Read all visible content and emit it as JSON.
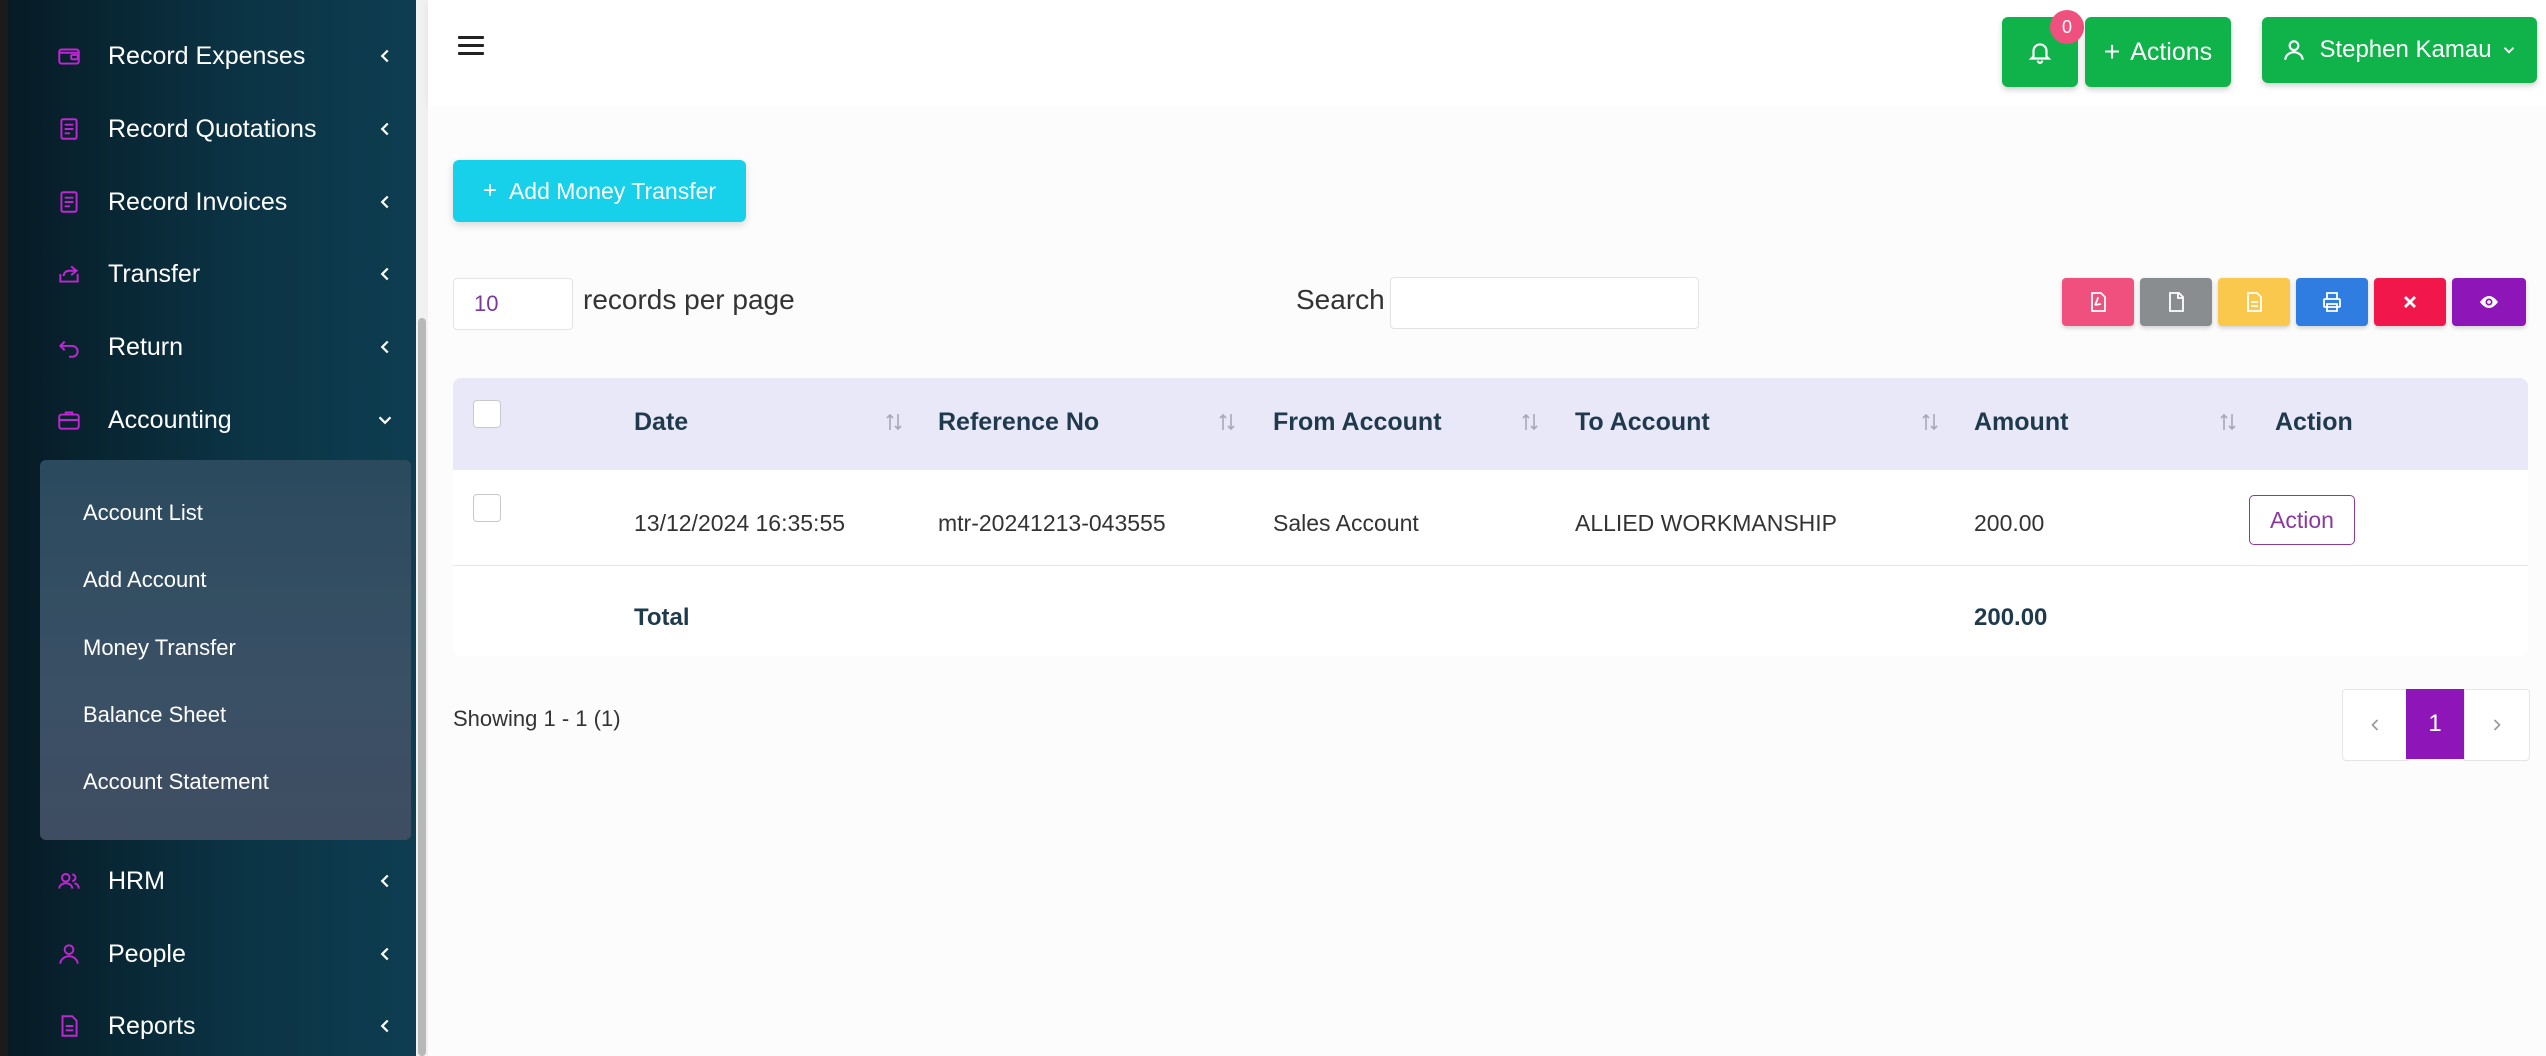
{
  "sidebar": {
    "items": [
      {
        "label": "Record Expenses",
        "icon": "wallet-icon"
      },
      {
        "label": "Record Quotations",
        "icon": "document-icon"
      },
      {
        "label": "Record Invoices",
        "icon": "invoice-icon"
      },
      {
        "label": "Transfer",
        "icon": "share-icon"
      },
      {
        "label": "Return",
        "icon": "return-icon"
      },
      {
        "label": "Accounting",
        "icon": "briefcase-icon"
      }
    ],
    "accounting_submenu": [
      "Account List",
      "Add Account",
      "Money Transfer",
      "Balance Sheet",
      "Account Statement"
    ],
    "bottom_items": [
      {
        "label": "HRM",
        "icon": "users-icon"
      },
      {
        "label": "People",
        "icon": "user-icon"
      },
      {
        "label": "Reports",
        "icon": "report-icon"
      }
    ]
  },
  "topbar": {
    "notification_count": "0",
    "actions_label": "Actions",
    "user_name": "Stephen Kamau"
  },
  "toolbar": {
    "add_button_label": "Add Money Transfer",
    "per_page_value": "10",
    "per_page_label": "records per page",
    "search_label": "Search",
    "search_value": "",
    "export_buttons": [
      {
        "icon": "pdf-icon",
        "color": "#f0507e"
      },
      {
        "icon": "file-icon",
        "color": "#8a8d90"
      },
      {
        "icon": "excel-icon",
        "color": "#fbc84e"
      },
      {
        "icon": "print-icon",
        "color": "#2f7de1"
      },
      {
        "icon": "close-icon",
        "color": "#f2174a"
      },
      {
        "icon": "eye-icon",
        "color": "#8e16b8"
      }
    ]
  },
  "table": {
    "columns": [
      "Date",
      "Reference No",
      "From Account",
      "To Account",
      "Amount",
      "Action"
    ],
    "rows": [
      {
        "date": "13/12/2024 16:35:55",
        "reference": "mtr-20241213-043555",
        "from": "Sales Account",
        "to": "ALLIED WORKMANSHIP",
        "amount": "200.00",
        "action": "Action"
      }
    ],
    "total_label": "Total",
    "total_amount": "200.00"
  },
  "pagination": {
    "showing": "Showing 1 - 1 (1)",
    "current_page": "1"
  },
  "colors": {
    "accent": "#8e16b8",
    "primary_green": "#0fb34a",
    "cyan": "#17d1eb",
    "table_header": "#e9e8f9"
  }
}
